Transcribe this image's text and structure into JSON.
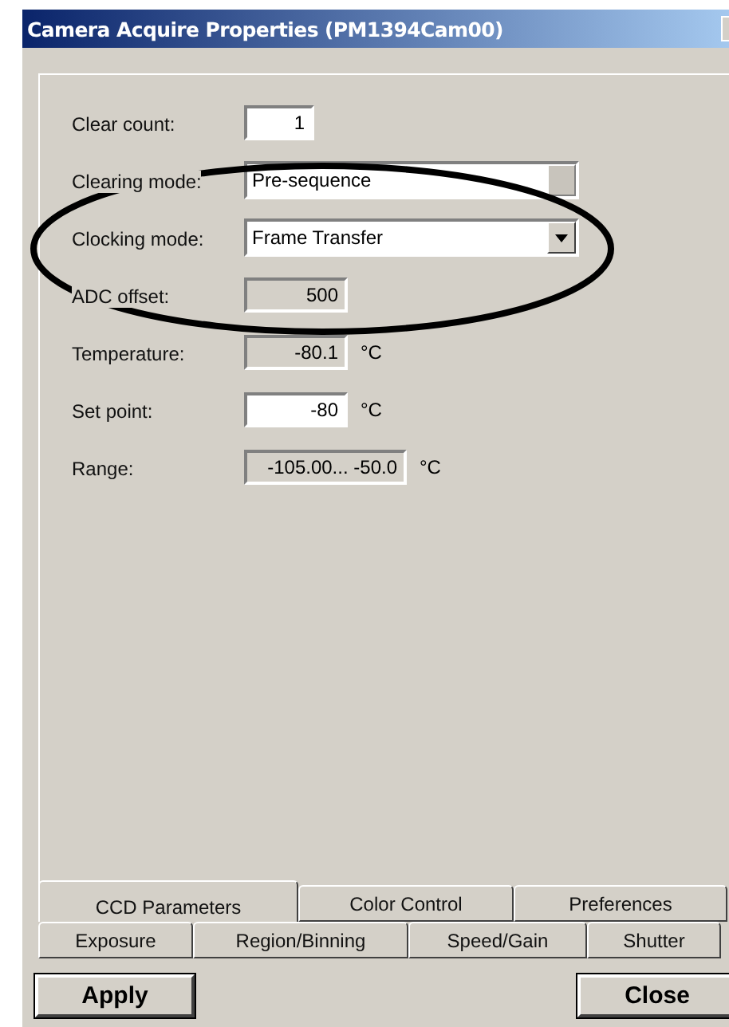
{
  "window": {
    "title": "Camera Acquire Properties (PM1394Cam00)"
  },
  "fields": [
    {
      "label": "Clear count:",
      "kind": "edit",
      "value": "1"
    },
    {
      "label": "Clearing mode:",
      "kind": "dropdown",
      "value": "Pre-sequence",
      "disabled": true
    },
    {
      "label": "Clocking mode:",
      "kind": "dropdown",
      "value": "Frame Transfer",
      "disabled": false
    },
    {
      "label": "ADC offset:",
      "kind": "readonly",
      "value": "500"
    },
    {
      "label": "Temperature:",
      "kind": "readonly",
      "value": "-80.1",
      "unit": "°C"
    },
    {
      "label": "Set point:",
      "kind": "edit",
      "value": "-80",
      "unit": "°C"
    },
    {
      "label": "Range:",
      "kind": "readonly",
      "value": "-105.00... -50.0",
      "unit": "°C"
    }
  ],
  "tab_rows": [
    [
      {
        "label": "CCD Parameters",
        "selected": true
      },
      {
        "label": "Color Control",
        "selected": false
      },
      {
        "label": "Preferences",
        "selected": false
      }
    ],
    [
      {
        "label": "Exposure",
        "selected": false
      },
      {
        "label": "Region/Binning",
        "selected": false
      },
      {
        "label": "Speed/Gain",
        "selected": false
      },
      {
        "label": "Shutter",
        "selected": false
      }
    ]
  ],
  "buttons": [
    {
      "label": "Apply"
    },
    {
      "label": "Close"
    }
  ]
}
